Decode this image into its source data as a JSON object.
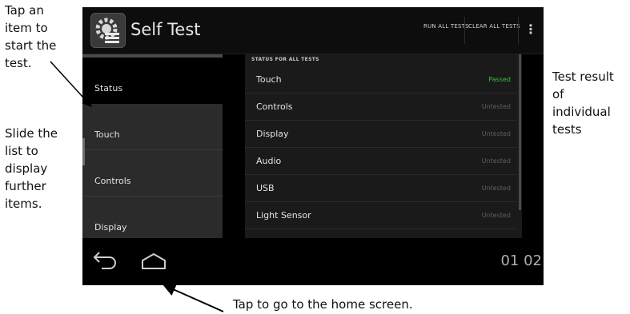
{
  "annotations": {
    "tap_item": "Tap an\nitem to\nstart the\ntest.",
    "slide_list": "Slide the\nlist to\ndisplay\nfurther\nitems.",
    "test_result": "Test result\nof\nindividual\ntests",
    "home_screen": "Tap to go to the home screen."
  },
  "app": {
    "title": "Self Test",
    "icon": "gear-list-icon"
  },
  "actionbar": {
    "run_all": "RUN ALL TESTS",
    "clear_all": "CLEAR ALL TESTS",
    "overflow_icon": "vertical-dots-icon"
  },
  "left_list": {
    "items": [
      {
        "label": "Status",
        "selected": true
      },
      {
        "label": "Touch",
        "selected": false
      },
      {
        "label": "Controls",
        "selected": false
      },
      {
        "label": "Display",
        "selected": false
      }
    ]
  },
  "right_list": {
    "header": "STATUS FOR ALL TESTS",
    "rows": [
      {
        "name": "Touch",
        "status": "Passed"
      },
      {
        "name": "Controls",
        "status": "Untested"
      },
      {
        "name": "Display",
        "status": "Untested"
      },
      {
        "name": "Audio",
        "status": "Untested"
      },
      {
        "name": "USB",
        "status": "Untested"
      },
      {
        "name": "Light Sensor",
        "status": "Untested"
      }
    ]
  },
  "navbar": {
    "back_icon": "back-arrow-icon",
    "home_icon": "home-icon",
    "clock": "01 02"
  },
  "colors": {
    "passed": "#3fbf3f",
    "untested": "#5f5f5f"
  }
}
